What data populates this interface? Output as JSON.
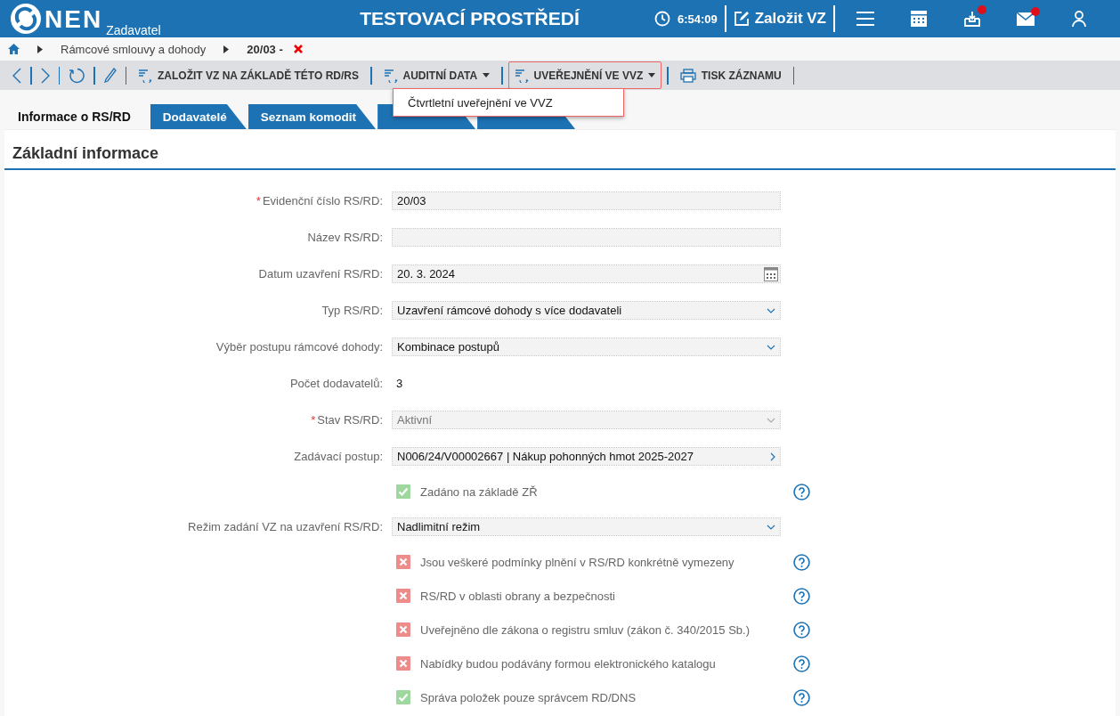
{
  "header": {
    "logo": "NEN",
    "subtitle": "Zadavatel",
    "title": "TESTOVACÍ PROSTŘEDÍ",
    "time": "6:54:09",
    "create_label": "Založit VZ",
    "icons": [
      {
        "kind": "menu",
        "badge": false
      },
      {
        "kind": "calculator",
        "badge": false
      },
      {
        "kind": "inbox",
        "badge": true
      },
      {
        "kind": "mail",
        "badge": true
      },
      {
        "kind": "user",
        "badge": false
      }
    ]
  },
  "breadcrumb": {
    "items": [
      "Rámcové smlouvy a dohody",
      "20/03 -"
    ]
  },
  "toolbar": {
    "nav": [
      {
        "kind": "back"
      },
      {
        "kind": "forward"
      },
      {
        "kind": "refresh"
      },
      {
        "kind": "edit"
      }
    ],
    "buttons": [
      {
        "label": "ZALOŽIT VZ NA ZÁKLADĚ TÉTO RD/RS",
        "kind": "action",
        "dropdown": false,
        "open": false
      },
      {
        "label": "AUDITNÍ DATA",
        "kind": "action",
        "dropdown": true,
        "open": false
      },
      {
        "label": "UVEŘEJNĚNÍ VE VVZ",
        "kind": "action",
        "dropdown": true,
        "open": true
      },
      {
        "label": "TISK ZÁZNAMU",
        "kind": "print",
        "dropdown": false,
        "open": false
      }
    ],
    "menu": [
      "Čtvrtletní uveřejnění ve VVZ"
    ]
  },
  "tabs": [
    {
      "label": "Informace o RS/RD",
      "selected": true
    },
    {
      "label": "Dodavatelé",
      "selected": false
    },
    {
      "label": "Seznam komodit",
      "selected": false
    },
    {
      "selected": false
    },
    {
      "selected": false
    }
  ],
  "section": {
    "title": "Základní informace",
    "rows": [
      {
        "kind": "field",
        "label": "Evidenční číslo RS/RD:",
        "marker": "*",
        "value": "20/03"
      },
      {
        "kind": "field",
        "label": "Název RS/RD:"
      },
      {
        "kind": "date",
        "label": "Datum uzavření RS/RD:",
        "value": "20. 3. 2024"
      },
      {
        "kind": "select",
        "label": "Typ RS/RD:",
        "disabled": false,
        "value": "Uzavření rámcové dohody s více dodavateli"
      },
      {
        "kind": "select",
        "label": "Výběr postupu rámcové dohody:",
        "disabled": false,
        "value": "Kombinace postupů"
      },
      {
        "kind": "text",
        "label": "Počet dodavatelů:",
        "value": "3"
      },
      {
        "kind": "select",
        "label": "Stav RS/RD:",
        "marker": "*",
        "disabled": true,
        "value": "Aktivní"
      },
      {
        "kind": "link",
        "label": "Zadávací postup:",
        "value": "N006/24/V00002667 | Nákup pohonných hmot 2025-2027"
      },
      {
        "kind": "checkbox",
        "label": "Zadáno na základě ZŘ",
        "checked": true
      },
      {
        "kind": "select",
        "label": "Režim zadání VZ na uzavření RS/RD:",
        "disabled": false,
        "value": "Nadlimitní režim"
      },
      {
        "kind": "checkbox",
        "label": "Jsou veškeré podmínky plnění v RS/RD konkrétně vymezeny",
        "checked": false
      },
      {
        "kind": "checkbox",
        "label": "RS/RD v oblasti obrany a bezpečnosti",
        "checked": false
      },
      {
        "kind": "checkbox",
        "label": "Uveřejněno dle zákona o registru smluv (zákon č. 340/2015 Sb.)",
        "checked": false
      },
      {
        "kind": "checkbox",
        "label": "Nabídky budou podávány formou elektronického katalogu",
        "checked": false
      },
      {
        "kind": "checkbox",
        "label": "Správa položek pouze správcem RD/DNS",
        "checked": true
      }
    ]
  }
}
